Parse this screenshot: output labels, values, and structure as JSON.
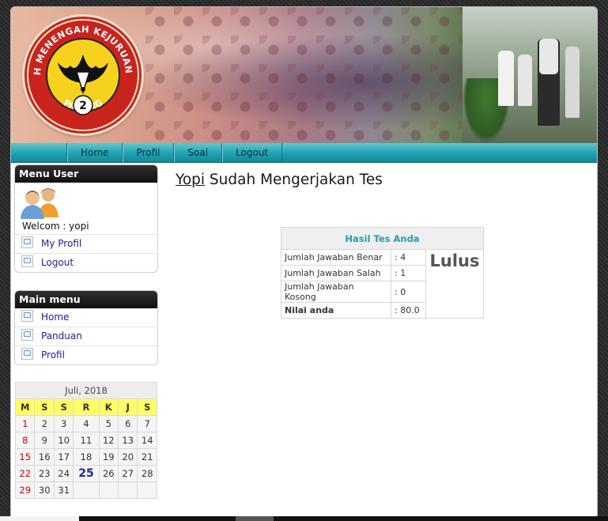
{
  "header": {
    "logo_text_top": "SEKOLAH MENENGAH KEJURUAN NEGERI",
    "logo_text_bottom": "PADANG",
    "logo_number": "2"
  },
  "nav": {
    "items": [
      {
        "label": "Home"
      },
      {
        "label": "Profil"
      },
      {
        "label": "Soal"
      },
      {
        "label": "Logout"
      }
    ]
  },
  "menu_user": {
    "title": "Menu User",
    "welcome": "Welcom : yopi",
    "items": [
      {
        "label": "My Profil"
      },
      {
        "label": "Logout"
      }
    ]
  },
  "main_menu": {
    "title": "Main menu",
    "items": [
      {
        "label": "Home"
      },
      {
        "label": "Panduan"
      },
      {
        "label": "Profil"
      }
    ]
  },
  "calendar": {
    "caption": "Juli, 2018",
    "weekdays": [
      "M",
      "S",
      "S",
      "R",
      "K",
      "J",
      "S"
    ],
    "weeks": [
      [
        "1",
        "2",
        "3",
        "4",
        "5",
        "6",
        "7"
      ],
      [
        "8",
        "9",
        "10",
        "11",
        "12",
        "13",
        "14"
      ],
      [
        "15",
        "16",
        "17",
        "18",
        "19",
        "20",
        "21"
      ],
      [
        "22",
        "23",
        "24",
        "25",
        "26",
        "27",
        "28"
      ],
      [
        "29",
        "30",
        "31",
        "",
        "",
        "",
        ""
      ]
    ],
    "today": "25"
  },
  "content": {
    "user_name": "Yopi",
    "title_rest": " Sudah Mengerjakan Tes",
    "result": {
      "heading": "Hasil Tes Anda",
      "rows": [
        {
          "label": "Jumlah Jawaban Benar",
          "value": ": 4"
        },
        {
          "label": "Jumlah Jawaban Salah",
          "value": ": 1"
        },
        {
          "label": "Jumlah Jawaban Kosong",
          "value": ": 0"
        },
        {
          "label": "Nilai anda",
          "value": ": 80.0"
        }
      ],
      "status": "Lulus"
    }
  },
  "colors": {
    "nav_accent": "#1fa2b1",
    "result_heading": "#2a9aa8",
    "calendar_weekday_bg": "#ffff66",
    "calendar_sunday": "#cc0000"
  }
}
